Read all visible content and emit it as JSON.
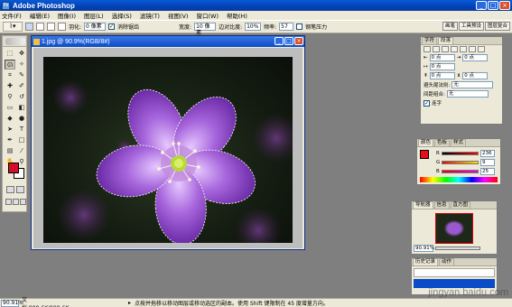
{
  "window": {
    "title": "Adobe Photoshop",
    "minimize": "_",
    "maximize": "□",
    "close": "×"
  },
  "menu": [
    "文件(F)",
    "编辑(E)",
    "图像(I)",
    "图层(L)",
    "选择(S)",
    "滤镜(T)",
    "视图(V)",
    "窗口(W)",
    "帮助(H)"
  ],
  "options": {
    "feather_label": "羽化:",
    "feather_value": "0 像素",
    "antialias_label": "消除锯齿",
    "width_label": "宽度:",
    "width_value": "10 像素",
    "contrast_label": "边对比度:",
    "contrast_value": "10%",
    "frequency_label": "频率:",
    "frequency_value": "57",
    "pressure_label": "钢笔压力"
  },
  "palette_well": [
    "画笔",
    "工具预设",
    "图层复合"
  ],
  "document": {
    "title": "1.jpg @ 90.9%(RGB/8#)"
  },
  "char_palette": {
    "tabs": [
      "字符",
      "段落"
    ],
    "indent_left": "0 点",
    "indent_right": "0 点",
    "indent_first": "0 点",
    "space_before": "0 点",
    "space_after": "0 点",
    "hyphen_label": "避头尾法则:",
    "hyphen_value": "无",
    "composer_label": "间距组合:",
    "composer_value": "无",
    "checkbox_label": "连字"
  },
  "color_palette": {
    "tabs": [
      "颜色",
      "色板",
      "样式"
    ],
    "r_label": "R",
    "r_value": "236",
    "g_label": "G",
    "g_value": "9",
    "b_label": "B",
    "b_value": "25"
  },
  "navigator": {
    "tabs": [
      "导航器",
      "信息",
      "直方图"
    ],
    "zoom": "90.91%"
  },
  "history": {
    "tabs": [
      "历史记录",
      "动作"
    ]
  },
  "status": {
    "zoom": "90.91%",
    "doc": "文档:999.6K/999.6K",
    "hint": "点按并拖移以移动图层或移动选区的副本。使用 Shift 键限制在 45 度增量方向。"
  },
  "watermark": "jingyan.baidu.com",
  "colors": {
    "fg": "#EC0919",
    "bg": "#FFFFFF",
    "titlebar": "#0A4CC8",
    "petal": "#9B59D0"
  }
}
